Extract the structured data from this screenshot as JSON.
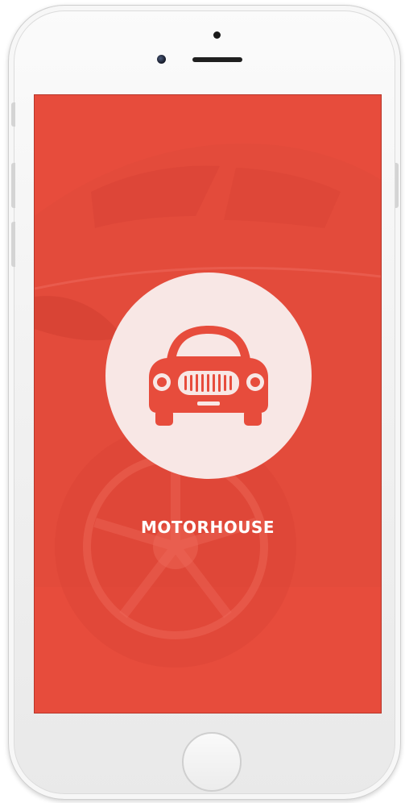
{
  "app": {
    "brand_name": "MOTORHOUSE"
  },
  "colors": {
    "accent": "#e74c3c",
    "logo_circle": "#f8e7e5",
    "text": "#ffffff"
  },
  "icons": {
    "logo": "car-front-icon"
  }
}
